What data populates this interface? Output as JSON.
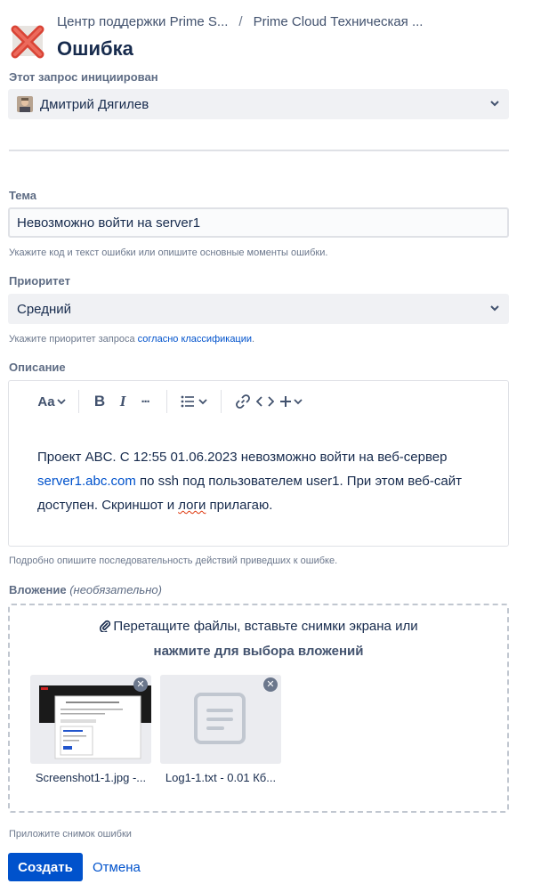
{
  "breadcrumb": {
    "item1": "Центр поддержки Prime S...",
    "separator": "/",
    "item2": "Prime Cloud Техническая ..."
  },
  "page_title": "Ошибка",
  "initiator": {
    "label": "Этот запрос инициирован",
    "value": "Дмитрий Дягилев"
  },
  "subject": {
    "label": "Тема",
    "value": "Невозможно войти на server1",
    "hint": "Укажите код и текст ошибки или опишите основные моменты ошибки."
  },
  "priority": {
    "label": "Приоритет",
    "value": "Средний",
    "hint_prefix": "Укажите приоритет запроса ",
    "hint_link": "согласно классификации",
    "hint_suffix": "."
  },
  "description": {
    "label": "Описание",
    "toolbar": {
      "text_style": "Aa",
      "bold": "B",
      "italic": "I",
      "more": "···"
    },
    "text_part1": "Проект ABC. С 12:55 01.06.2023 невозможно войти на веб-сервер ",
    "text_link": "server1.abc.com",
    "text_part2": " по ssh под пользователем user1. При этом веб-сайт доступен. Скриншот и ",
    "text_misspelled": "логи",
    "text_part3": " прилагаю.",
    "hint": "Подробно опишите последовательность действий приведших к ошибке."
  },
  "attachment": {
    "label": "Вложение",
    "label_optional": "(необязательно)",
    "dropzone_line1": "Перетащите файлы, вставьте снимки экрана или",
    "dropzone_line2": "нажмите для выбора вложений",
    "files": [
      {
        "name": "Screenshot1-1.jpg -..."
      },
      {
        "name": "Log1-1.txt - 0.01 Кб..."
      }
    ],
    "hint": "Приложите снимок ошибки"
  },
  "actions": {
    "create": "Создать",
    "cancel": "Отмена"
  },
  "colors": {
    "primary": "#0052cc",
    "text": "#172b4d",
    "subtle": "#5e6c84",
    "field_bg": "#f0f1f4",
    "error_red": "#de350b"
  }
}
